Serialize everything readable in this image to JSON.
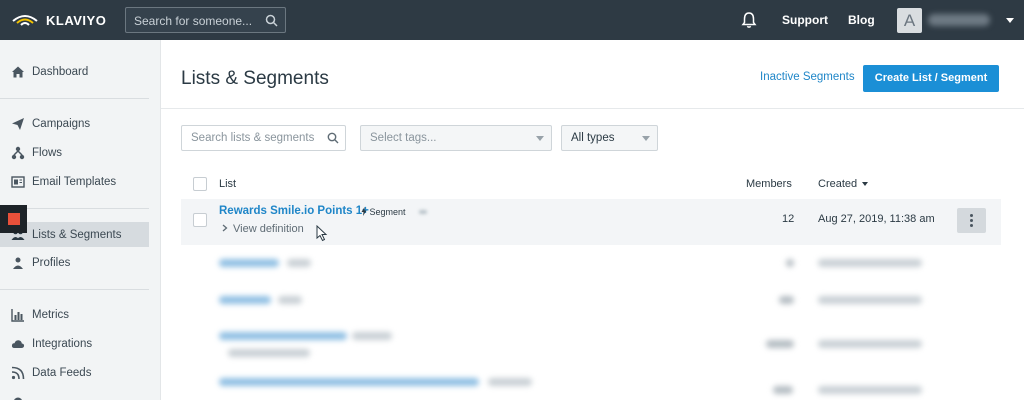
{
  "app": {
    "brand": "KLAVIYO"
  },
  "topbar": {
    "search_placeholder": "Search for someone...",
    "support_label": "Support",
    "blog_label": "Blog",
    "avatar_initial": "A"
  },
  "sidebar": {
    "items": [
      {
        "label": "Dashboard",
        "icon": "home-icon"
      },
      {
        "label": "Campaigns",
        "icon": "paper-plane-icon"
      },
      {
        "label": "Flows",
        "icon": "flows-icon"
      },
      {
        "label": "Email Templates",
        "icon": "email-template-icon"
      },
      {
        "label": "Lists & Segments",
        "icon": "people-icon",
        "active": true
      },
      {
        "label": "Profiles",
        "icon": "profile-icon"
      },
      {
        "label": "Metrics",
        "icon": "bar-chart-icon"
      },
      {
        "label": "Integrations",
        "icon": "cloud-icon"
      },
      {
        "label": "Data Feeds",
        "icon": "rss-icon"
      }
    ]
  },
  "main": {
    "title": "Lists & Segments",
    "inactive_segments_label": "Inactive Segments",
    "create_button_label": "Create List / Segment",
    "filters": {
      "search_placeholder": "Search lists & segments",
      "tags_placeholder": "Select tags...",
      "type_value": "All types"
    },
    "table": {
      "headers": {
        "list": "List",
        "members": "Members",
        "created": "Created"
      },
      "rows": [
        {
          "name": "Rewards Smile.io Points 1+",
          "type_tag": "Segment",
          "view_definition": "View definition",
          "members": "12",
          "created": "Aug 27, 2019, 11:38 am"
        }
      ]
    }
  },
  "colors": {
    "topbar": "#2e3a44",
    "accent": "#1b8fd6",
    "link": "#1f86c8",
    "sidebar_bg": "#f2f4f5",
    "sidebar_active": "#d6dbdf"
  }
}
